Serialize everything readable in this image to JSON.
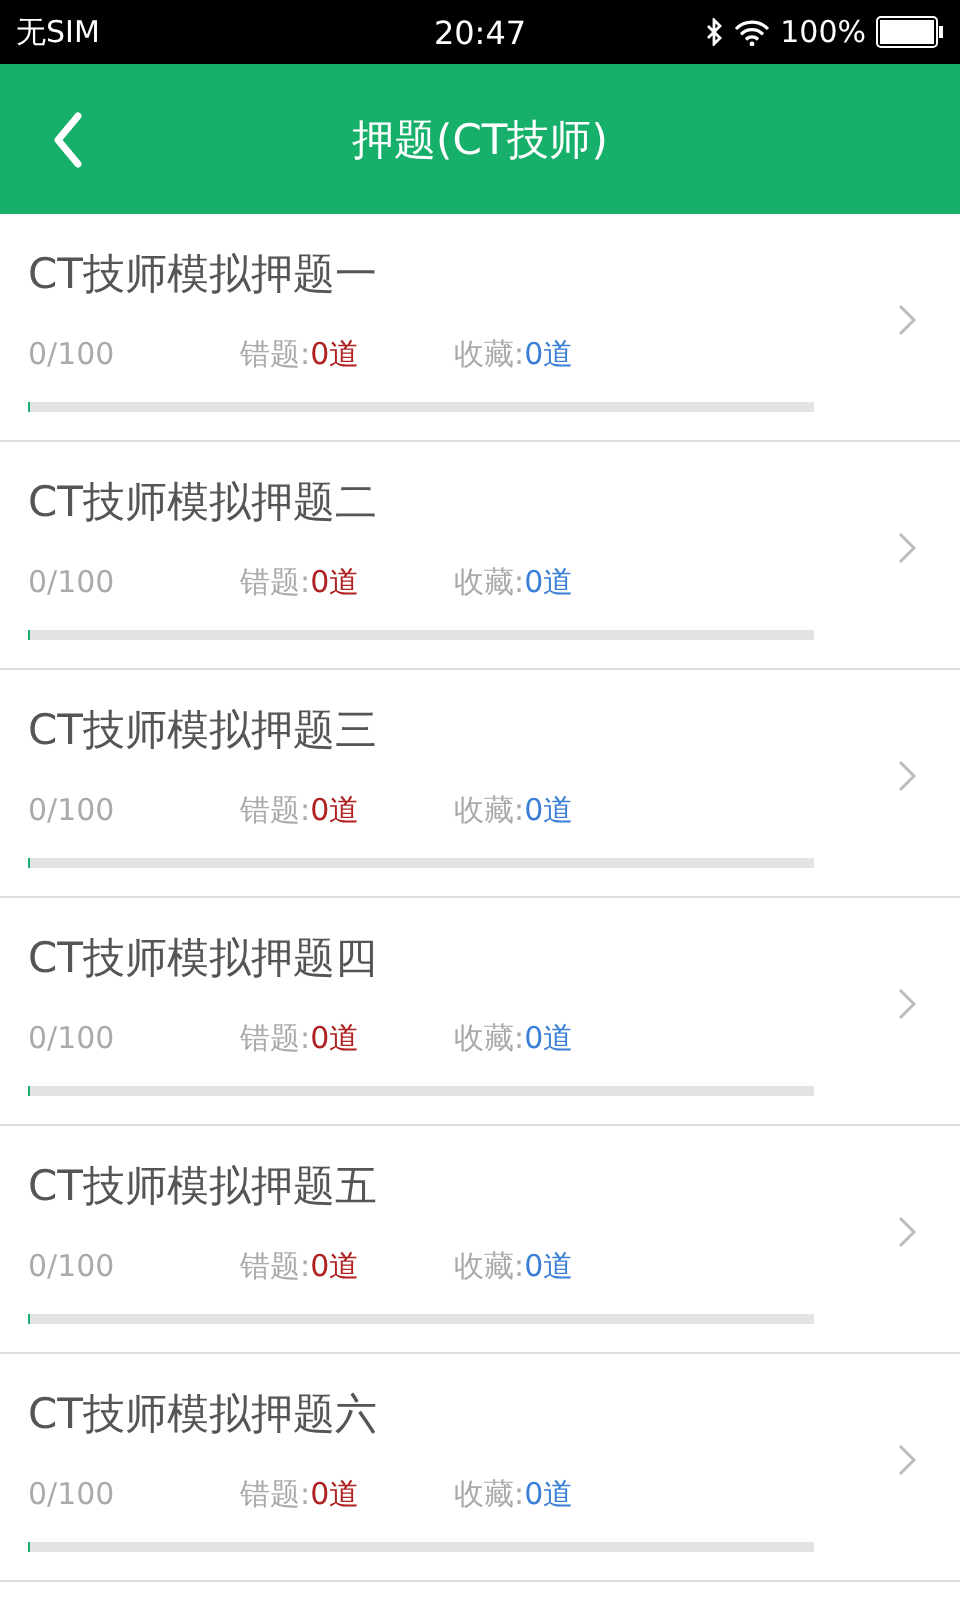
{
  "status_bar": {
    "carrier": "无SIM",
    "time": "20:47",
    "battery": "100%"
  },
  "header": {
    "title": "押题(CT技师)"
  },
  "exams": [
    {
      "title": "CT技师模拟押题一",
      "progress": "0/100",
      "wrong_label": "错题:",
      "wrong_count": "0道",
      "fav_label": "收藏:",
      "fav_count": "0道",
      "level": 0
    },
    {
      "title": "CT技师模拟押题二",
      "progress": "0/100",
      "wrong_label": "错题:",
      "wrong_count": "0道",
      "fav_label": "收藏:",
      "fav_count": "0道",
      "level": 0
    },
    {
      "title": "CT技师模拟押题三",
      "progress": "0/100",
      "wrong_label": "错题:",
      "wrong_count": "0道",
      "fav_label": "收藏:",
      "fav_count": "0道",
      "level": 0
    },
    {
      "title": "CT技师模拟押题四",
      "progress": "0/100",
      "wrong_label": "错题:",
      "wrong_count": "0道",
      "fav_label": "收藏:",
      "fav_count": "0道",
      "level": 0
    },
    {
      "title": "CT技师模拟押题五",
      "progress": "0/100",
      "wrong_label": "错题:",
      "wrong_count": "0道",
      "fav_label": "收藏:",
      "fav_count": "0道",
      "level": 0
    },
    {
      "title": "CT技师模拟押题六",
      "progress": "0/100",
      "wrong_label": "错题:",
      "wrong_count": "0道",
      "fav_label": "收藏:",
      "fav_count": "0道",
      "level": 0
    }
  ]
}
